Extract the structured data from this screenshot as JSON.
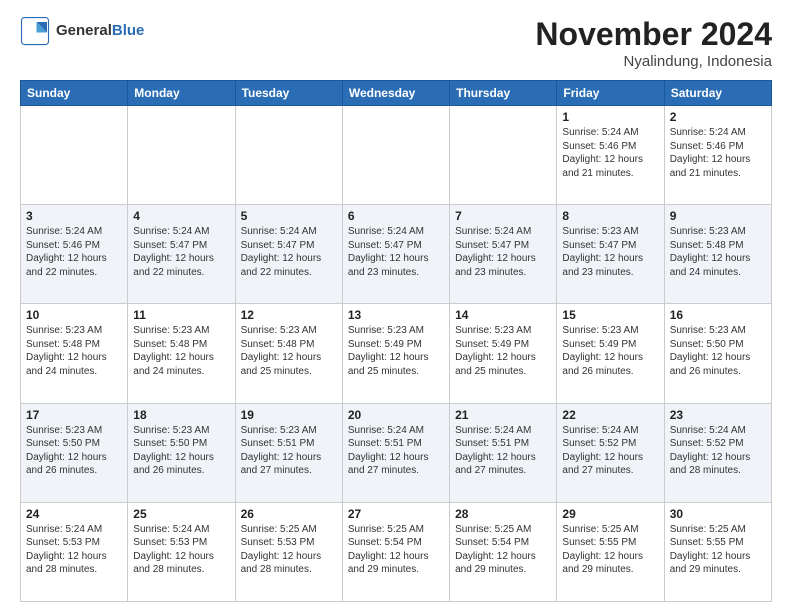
{
  "header": {
    "logo": {
      "general": "General",
      "blue": "Blue"
    },
    "title": "November 2024",
    "subtitle": "Nyalindung, Indonesia"
  },
  "weekdays": [
    "Sunday",
    "Monday",
    "Tuesday",
    "Wednesday",
    "Thursday",
    "Friday",
    "Saturday"
  ],
  "weeks": [
    [
      {
        "day": "",
        "info": ""
      },
      {
        "day": "",
        "info": ""
      },
      {
        "day": "",
        "info": ""
      },
      {
        "day": "",
        "info": ""
      },
      {
        "day": "",
        "info": ""
      },
      {
        "day": "1",
        "info": "Sunrise: 5:24 AM\nSunset: 5:46 PM\nDaylight: 12 hours and 21 minutes."
      },
      {
        "day": "2",
        "info": "Sunrise: 5:24 AM\nSunset: 5:46 PM\nDaylight: 12 hours and 21 minutes."
      }
    ],
    [
      {
        "day": "3",
        "info": "Sunrise: 5:24 AM\nSunset: 5:46 PM\nDaylight: 12 hours and 22 minutes."
      },
      {
        "day": "4",
        "info": "Sunrise: 5:24 AM\nSunset: 5:47 PM\nDaylight: 12 hours and 22 minutes."
      },
      {
        "day": "5",
        "info": "Sunrise: 5:24 AM\nSunset: 5:47 PM\nDaylight: 12 hours and 22 minutes."
      },
      {
        "day": "6",
        "info": "Sunrise: 5:24 AM\nSunset: 5:47 PM\nDaylight: 12 hours and 23 minutes."
      },
      {
        "day": "7",
        "info": "Sunrise: 5:24 AM\nSunset: 5:47 PM\nDaylight: 12 hours and 23 minutes."
      },
      {
        "day": "8",
        "info": "Sunrise: 5:23 AM\nSunset: 5:47 PM\nDaylight: 12 hours and 23 minutes."
      },
      {
        "day": "9",
        "info": "Sunrise: 5:23 AM\nSunset: 5:48 PM\nDaylight: 12 hours and 24 minutes."
      }
    ],
    [
      {
        "day": "10",
        "info": "Sunrise: 5:23 AM\nSunset: 5:48 PM\nDaylight: 12 hours and 24 minutes."
      },
      {
        "day": "11",
        "info": "Sunrise: 5:23 AM\nSunset: 5:48 PM\nDaylight: 12 hours and 24 minutes."
      },
      {
        "day": "12",
        "info": "Sunrise: 5:23 AM\nSunset: 5:48 PM\nDaylight: 12 hours and 25 minutes."
      },
      {
        "day": "13",
        "info": "Sunrise: 5:23 AM\nSunset: 5:49 PM\nDaylight: 12 hours and 25 minutes."
      },
      {
        "day": "14",
        "info": "Sunrise: 5:23 AM\nSunset: 5:49 PM\nDaylight: 12 hours and 25 minutes."
      },
      {
        "day": "15",
        "info": "Sunrise: 5:23 AM\nSunset: 5:49 PM\nDaylight: 12 hours and 26 minutes."
      },
      {
        "day": "16",
        "info": "Sunrise: 5:23 AM\nSunset: 5:50 PM\nDaylight: 12 hours and 26 minutes."
      }
    ],
    [
      {
        "day": "17",
        "info": "Sunrise: 5:23 AM\nSunset: 5:50 PM\nDaylight: 12 hours and 26 minutes."
      },
      {
        "day": "18",
        "info": "Sunrise: 5:23 AM\nSunset: 5:50 PM\nDaylight: 12 hours and 26 minutes."
      },
      {
        "day": "19",
        "info": "Sunrise: 5:23 AM\nSunset: 5:51 PM\nDaylight: 12 hours and 27 minutes."
      },
      {
        "day": "20",
        "info": "Sunrise: 5:24 AM\nSunset: 5:51 PM\nDaylight: 12 hours and 27 minutes."
      },
      {
        "day": "21",
        "info": "Sunrise: 5:24 AM\nSunset: 5:51 PM\nDaylight: 12 hours and 27 minutes."
      },
      {
        "day": "22",
        "info": "Sunrise: 5:24 AM\nSunset: 5:52 PM\nDaylight: 12 hours and 27 minutes."
      },
      {
        "day": "23",
        "info": "Sunrise: 5:24 AM\nSunset: 5:52 PM\nDaylight: 12 hours and 28 minutes."
      }
    ],
    [
      {
        "day": "24",
        "info": "Sunrise: 5:24 AM\nSunset: 5:53 PM\nDaylight: 12 hours and 28 minutes."
      },
      {
        "day": "25",
        "info": "Sunrise: 5:24 AM\nSunset: 5:53 PM\nDaylight: 12 hours and 28 minutes."
      },
      {
        "day": "26",
        "info": "Sunrise: 5:25 AM\nSunset: 5:53 PM\nDaylight: 12 hours and 28 minutes."
      },
      {
        "day": "27",
        "info": "Sunrise: 5:25 AM\nSunset: 5:54 PM\nDaylight: 12 hours and 29 minutes."
      },
      {
        "day": "28",
        "info": "Sunrise: 5:25 AM\nSunset: 5:54 PM\nDaylight: 12 hours and 29 minutes."
      },
      {
        "day": "29",
        "info": "Sunrise: 5:25 AM\nSunset: 5:55 PM\nDaylight: 12 hours and 29 minutes."
      },
      {
        "day": "30",
        "info": "Sunrise: 5:25 AM\nSunset: 5:55 PM\nDaylight: 12 hours and 29 minutes."
      }
    ]
  ]
}
